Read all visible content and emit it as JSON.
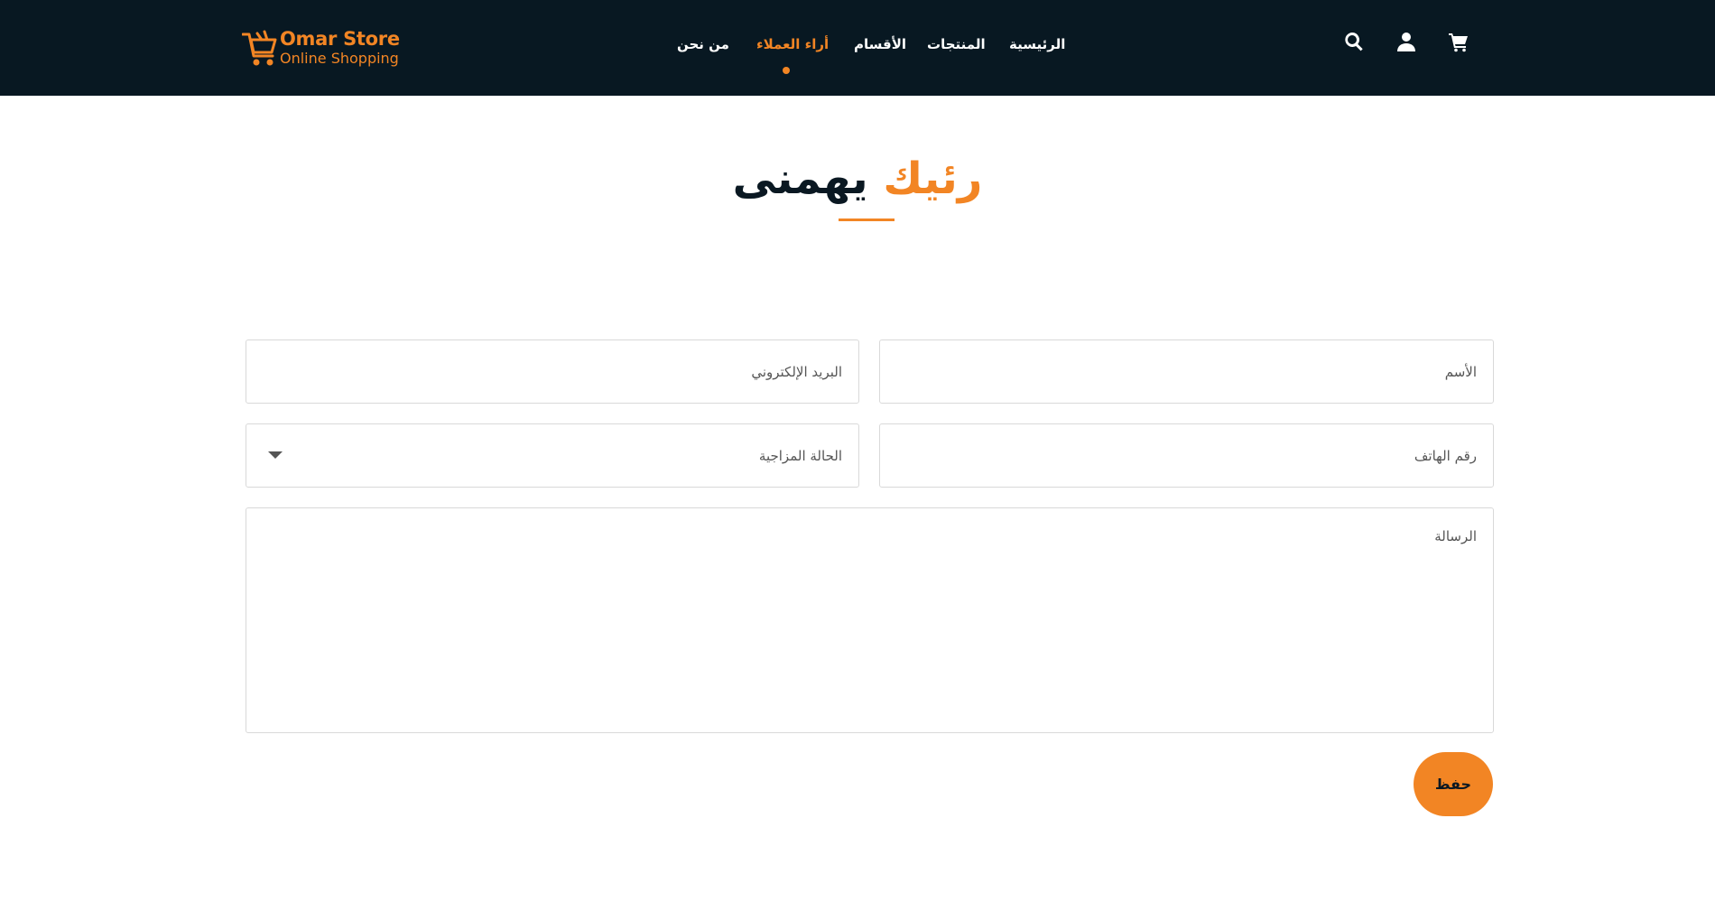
{
  "brand": {
    "title": "Omar Store",
    "subtitle": "Online Shopping",
    "color": "#f28524"
  },
  "nav": {
    "items": [
      {
        "label": "الرئيسية",
        "active": false
      },
      {
        "label": "المنتجات",
        "active": false
      },
      {
        "label": "الأقسام",
        "active": false
      },
      {
        "label": "أراء العملاء",
        "active": true
      },
      {
        "label": "من نحن",
        "active": false
      }
    ],
    "icons": [
      "search-icon",
      "user-icon",
      "cart-icon"
    ],
    "background": "#081822"
  },
  "page": {
    "title_part1": "رئيك",
    "title_part2": "يهمنى"
  },
  "form": {
    "name_placeholder": "الأسم",
    "email_placeholder": "البريد الإلكتروني",
    "phone_placeholder": "رقم الهاتف",
    "status_selected": "الحالة المزاجية",
    "message_placeholder": "الرسالة",
    "save_label": "حفظ"
  }
}
